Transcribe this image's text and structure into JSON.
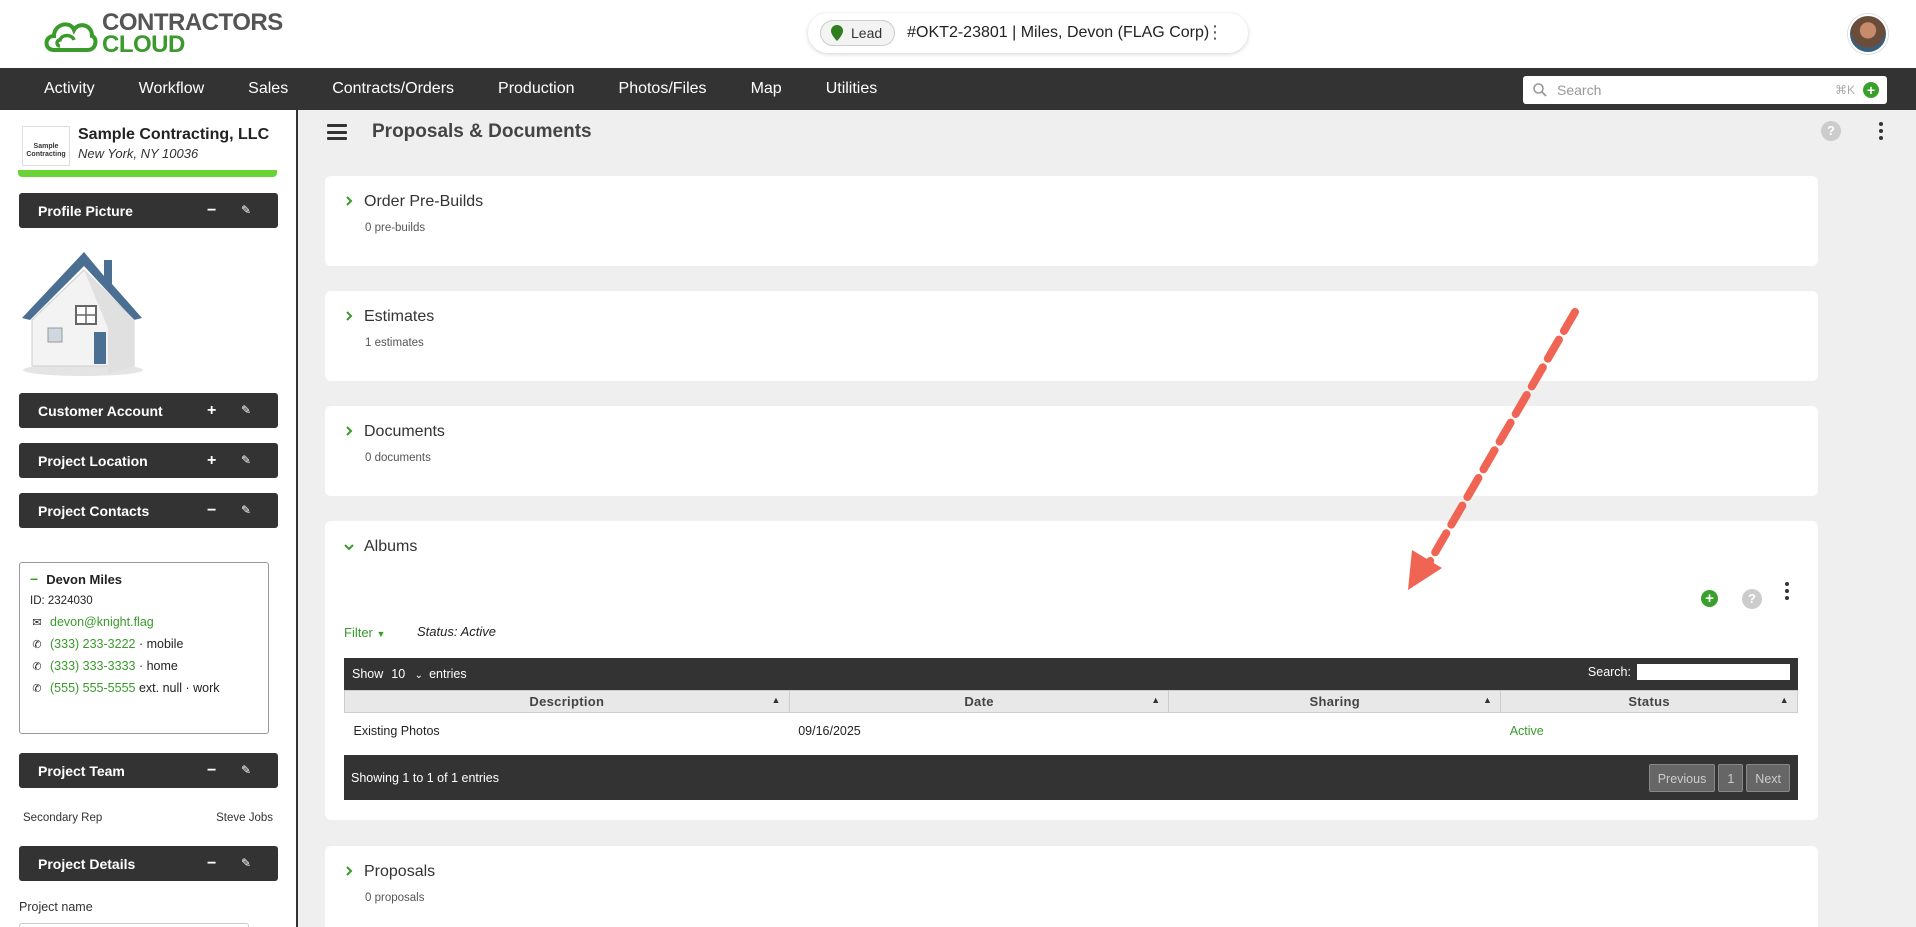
{
  "brand": {
    "line1": "CONTRACTORS",
    "line2": "CLOUD"
  },
  "job": {
    "stage": "Lead",
    "title": "#OKT2-23801 | Miles, Devon (FLAG Corp)"
  },
  "nav": [
    "Activity",
    "Workflow",
    "Sales",
    "Contracts/Orders",
    "Production",
    "Photos/Files",
    "Map",
    "Utilities"
  ],
  "search": {
    "placeholder": "Search",
    "shortcut": "⌘K"
  },
  "company": {
    "name": "Sample Contracting, LLC",
    "address": "New York, NY 10036",
    "logo_text": "Sample Contracting"
  },
  "sidebar": {
    "profile_picture": "Profile Picture",
    "customer_account": "Customer Account",
    "project_location": "Project Location",
    "project_contacts": "Project Contacts",
    "project_team": "Project Team",
    "project_details": "Project Details"
  },
  "contact": {
    "name": "Devon Miles",
    "id": "ID: 2324030",
    "email": "devon@knight.flag",
    "phones": [
      {
        "number": "(333) 233-3222",
        "suffix": " · mobile"
      },
      {
        "number": "(333) 333-3333",
        "suffix": " · home"
      },
      {
        "number": "(555) 555-5555",
        "suffix": " ext. null · work"
      }
    ]
  },
  "team": {
    "role": "Secondary Rep",
    "person": "Steve Jobs"
  },
  "details": {
    "project_name_label": "Project name"
  },
  "page_title": "Proposals & Documents",
  "sections": {
    "prebuilds": {
      "title": "Order Pre-Builds",
      "count": "0 pre-builds"
    },
    "estimates": {
      "title": "Estimates",
      "count": "1 estimates"
    },
    "documents": {
      "title": "Documents",
      "count": "0 documents"
    },
    "albums": {
      "title": "Albums"
    },
    "proposals": {
      "title": "Proposals",
      "count": "0 proposals"
    }
  },
  "albums": {
    "filter": "Filter",
    "status_filter": "Status: Active",
    "show": "Show",
    "page_size": "10",
    "entries": "entries",
    "search_label": "Search:",
    "columns": [
      "Description",
      "Date",
      "Sharing",
      "Status"
    ],
    "rows": [
      {
        "description": "Existing Photos",
        "date": "09/16/2025",
        "sharing": "",
        "status": "Active"
      }
    ],
    "info": "Showing 1 to 1 of 1 entries",
    "pager": {
      "prev": "Previous",
      "page": "1",
      "next": "Next"
    }
  },
  "colors": {
    "accent_green": "#3a9a2c",
    "dark_bar": "#333333",
    "annotation_arrow": "#f06454"
  }
}
